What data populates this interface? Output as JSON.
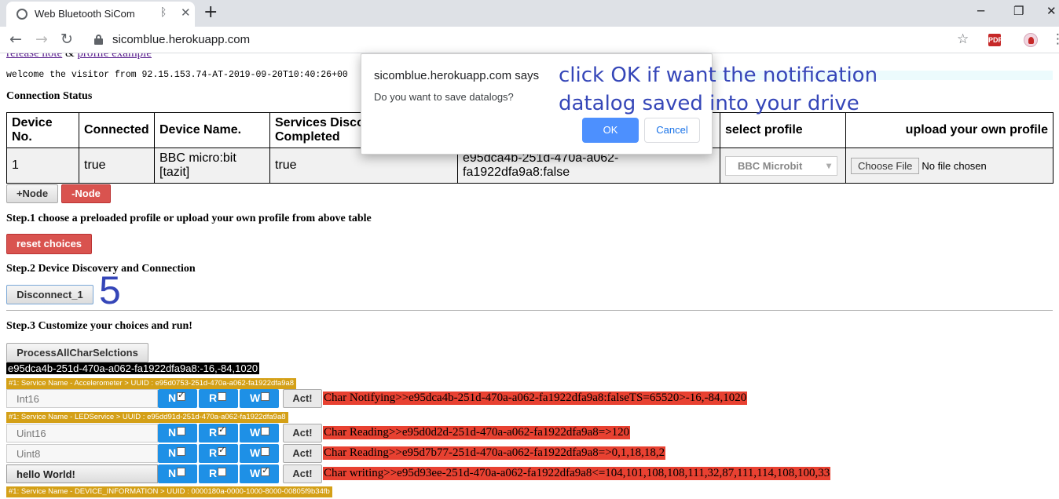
{
  "browser": {
    "tab_title": "Web Bluetooth SiCom",
    "tab_bluetooth_icon": "bluetooth-icon",
    "tab_close": "✕",
    "new_tab": "+",
    "url": "sicomblue.herokuapp.com",
    "window_controls": [
      "─",
      "❐",
      "✕"
    ]
  },
  "header": {
    "link_release": "release note",
    "link_sep": " & ",
    "link_profile": "profile example",
    "welcome": "welcome the visitor from 92.15.153.74-AT-2019-09-20T10:40:26+00"
  },
  "connection_status": {
    "title": "Connection Status",
    "columns": [
      "Device No.",
      "Connected",
      "Device Name.",
      "Services Discovery Completed",
      "",
      "",
      "select profile",
      "upload your own profile"
    ],
    "row": {
      "device_no": "1",
      "connected": "true",
      "device_name": "BBC micro:bit [tazit]",
      "services_completed": "true",
      "uuid_status": "e95dca4b-251d-470a-a062-fa1922dfa9a8:false",
      "profile_selected": "BBC Microbit",
      "choose_file": "Choose File",
      "no_file": "No file chosen"
    }
  },
  "buttons": {
    "add_node": "+Node",
    "remove_node": "-Node",
    "reset_choices": "reset choices",
    "disconnect": "Disconnect_1",
    "process_all": "ProcessAllCharSelctions"
  },
  "steps": {
    "step1": "Step.1 choose a preloaded profile or upload your own profile from above table",
    "step2": "Step.2 Device Discovery and Connection",
    "step3": "Step.3 Customize your choices and run!"
  },
  "annotation_number": "5",
  "uuid_value": "e95dca4b-251d-470a-a062-fa1922dfa9a8:-16,-84,1020",
  "services": [
    "#1: Service Name - Accelerometer > UUID : e95d0753-251d-470a-a062-fa1922dfa9a8",
    "#1: Service Name - LEDService > UUID : e95dd91d-251d-470a-a062-fa1922dfa9a8",
    "#1: Service Name - DEVICE_INFORMATION > UUID : 0000180a-0000-1000-8000-00805f9b34fb"
  ],
  "characteristics": [
    {
      "name": "Int16",
      "n": true,
      "r": false,
      "w": false,
      "act": "Act!",
      "result": "Char Notifying>>e95dca4b-251d-470a-a062-fa1922dfa9a8:falseTS=65520>-16,-84,1020"
    },
    {
      "name": "Uint16",
      "n": false,
      "r": true,
      "w": false,
      "act": "Act!",
      "result": "Char Reading>>e95d0d2d-251d-470a-a062-fa1922dfa9a8=>120"
    },
    {
      "name": "Uint8",
      "n": false,
      "r": true,
      "w": false,
      "act": "Act!",
      "result": "Char Reading>>e95d7b77-251d-470a-a062-fa1922dfa9a8=>0,1,18,18,2"
    },
    {
      "name": "hello World!",
      "n": false,
      "r": false,
      "w": true,
      "act": "Act!",
      "result": "Char writing>>e95d93ee-251d-470a-a062-fa1922dfa9a8<=104,101,108,108,111,32,87,111,114,108,100,33"
    }
  ],
  "option_labels": {
    "n": "N",
    "r": "R",
    "w": "W"
  },
  "dialog": {
    "title": "sicomblue.herokuapp.com says",
    "message": "Do you want to save datalogs?",
    "ok": "OK",
    "cancel": "Cancel"
  },
  "annotation_text": [
    "click OK if want the notification",
    "datalog saved into your drive"
  ],
  "colors": {
    "accent_blue": "#1e90e6",
    "result_red": "#e84131",
    "service_gold": "#d4a017",
    "annotation_blue": "#3546b8"
  }
}
